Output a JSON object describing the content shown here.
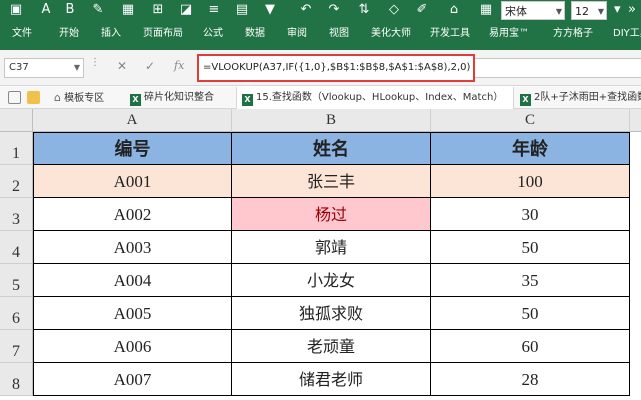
{
  "ribbon": {
    "font_name": "宋体",
    "font_size": "12",
    "tabs": [
      "文件",
      "开始",
      "插入",
      "页面布局",
      "公式",
      "数据",
      "审阅",
      "视图",
      "美化大师",
      "开发工具",
      "易用宝™",
      "方方格子",
      "DIY工具"
    ],
    "bg_color": "#217346"
  },
  "formula_bar": {
    "name_box": "C37",
    "fx_label": "fx",
    "formula": "=VLOOKUP(A37,IF({1,0},$B$1:$B$8,$A$1:$A$8),2,0)",
    "highlight_color": "#e03c3c"
  },
  "doc_tabs": [
    {
      "label": "模板专区",
      "icon": "home-icon"
    },
    {
      "label": "碎片化知识整合",
      "icon": "excel-icon"
    },
    {
      "label": "15.查找函数（Vlookup、HLookup、Index、Match）",
      "icon": "excel-icon",
      "active": true
    },
    {
      "label": "2队+子沐雨田+查找函数",
      "icon": "excel-icon"
    }
  ],
  "sheet": {
    "columns": [
      "A",
      "B",
      "C"
    ],
    "row_numbers": [
      "1",
      "2",
      "3",
      "4",
      "5",
      "6",
      "7",
      "8"
    ],
    "header": [
      "编号",
      "姓名",
      "年龄"
    ],
    "rows": [
      [
        "A001",
        "张三丰",
        "100"
      ],
      [
        "A002",
        "杨过",
        "30"
      ],
      [
        "A003",
        "郭靖",
        "50"
      ],
      [
        "A004",
        "小龙女",
        "35"
      ],
      [
        "A005",
        "独孤求败",
        "50"
      ],
      [
        "A006",
        "老顽童",
        "60"
      ],
      [
        "A007",
        "储君老师",
        "28"
      ]
    ],
    "header_fill": "#8cb4e2",
    "highlight_row_fill": "#fce4d6",
    "highlight_cell_fill": "#ffc7ce"
  }
}
